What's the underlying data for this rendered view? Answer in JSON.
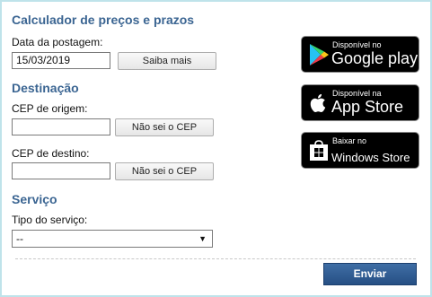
{
  "calculator": {
    "title": "Calculador de preços e prazos"
  },
  "postagem": {
    "label": "Data da postagem:",
    "date_value": "15/03/2019",
    "saiba_mais_label": "Saiba mais"
  },
  "destinacao": {
    "title": "Destinação",
    "origem_label": "CEP de origem:",
    "origem_value": "",
    "origem_button": "Não sei o CEP",
    "destino_label": "CEP de destino:",
    "destino_value": "",
    "destino_button": "Não sei o CEP"
  },
  "servico": {
    "title": "Serviço",
    "tipo_label": "Tipo do serviço:",
    "selected": "--"
  },
  "submit_label": "Enviar",
  "badges": {
    "google": {
      "small": "Disponível no",
      "big": "Google play",
      "icon": "google-play-icon"
    },
    "apple": {
      "small": "Disponível na",
      "big": "App Store",
      "icon": "apple-icon"
    },
    "windows": {
      "small": "Baixar no",
      "big": "Windows Store",
      "icon": "windows-store-icon"
    }
  },
  "colors": {
    "section_title": "#3b6592",
    "frame_border": "#bfe3ea",
    "primary_button": "#2f5c93"
  }
}
